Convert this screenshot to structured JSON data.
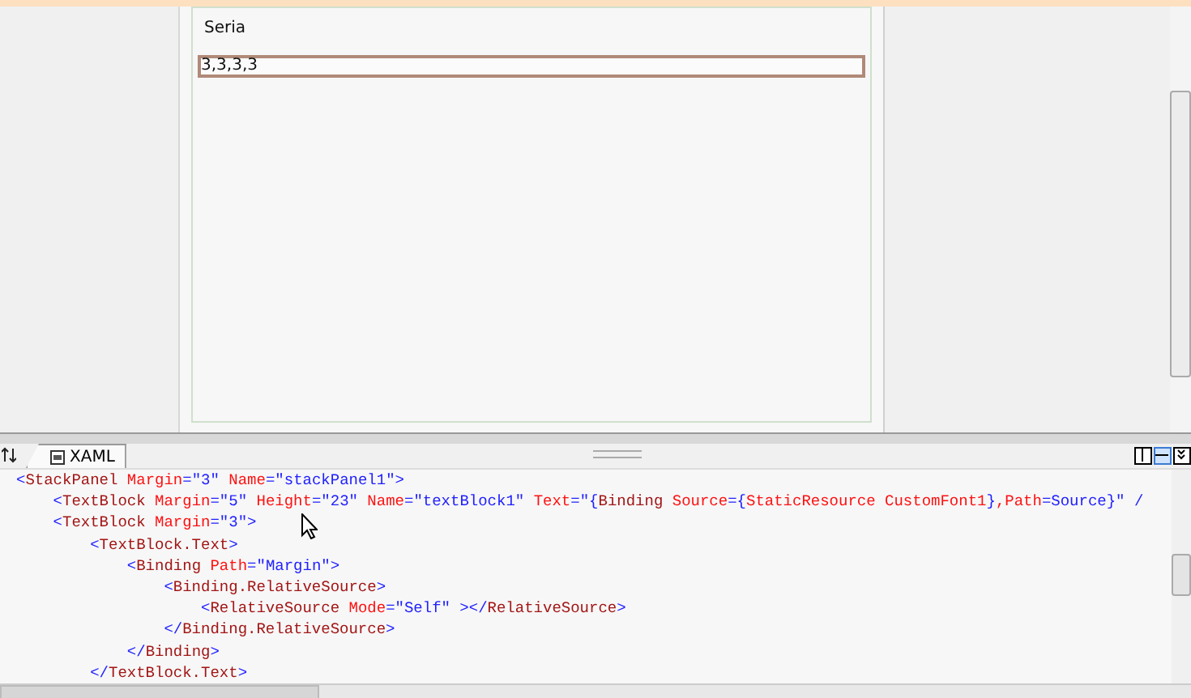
{
  "designer": {
    "label_text": "Seria",
    "textbox_value": "3,3,3,3"
  },
  "editor_tabs": [
    {
      "label": "XAML",
      "selected": true
    }
  ],
  "view_buttons": [
    {
      "kind": "vertical-split",
      "selected": false
    },
    {
      "kind": "horizontal-split",
      "selected": true
    },
    {
      "kind": "collapse",
      "selected": false
    }
  ],
  "code_lines": [
    {
      "tokens": [
        {
          "kind": "punct",
          "text": "<"
        },
        {
          "kind": "tag",
          "text": "StackPanel"
        },
        {
          "kind": "attr",
          "text": " Margin"
        },
        {
          "kind": "value",
          "text": "=\"3\""
        },
        {
          "kind": "attr",
          "text": " Name"
        },
        {
          "kind": "value",
          "text": "=\"stackPanel1\">"
        }
      ],
      "children": [
        {
          "tokens": [
            {
              "kind": "punct",
              "text": "<"
            },
            {
              "kind": "tag",
              "text": "TextBlock"
            },
            {
              "kind": "attr",
              "text": " Margin"
            },
            {
              "kind": "value",
              "text": "=\"5\""
            },
            {
              "kind": "attr",
              "text": " Height"
            },
            {
              "kind": "value",
              "text": "=\"23\""
            },
            {
              "kind": "attr",
              "text": " Name"
            },
            {
              "kind": "value",
              "text": "=\"textBlock1\""
            },
            {
              "kind": "attr",
              "text": " Text"
            },
            {
              "kind": "value",
              "text": "=\"{"
            },
            {
              "kind": "tag",
              "text": "Binding"
            },
            {
              "kind": "attr",
              "text": " Source"
            },
            {
              "kind": "value",
              "text": "={"
            },
            {
              "kind": "attr",
              "text": "StaticResource CustomFont1"
            },
            {
              "kind": "value",
              "text": "}"
            },
            {
              "kind": "attr",
              "text": ",Path"
            },
            {
              "kind": "value",
              "text": "=Source}\" /"
            }
          ]
        },
        {
          "tokens": [
            {
              "kind": "punct",
              "text": "<"
            },
            {
              "kind": "tag",
              "text": "TextBlock"
            },
            {
              "kind": "attr",
              "text": " Margin"
            },
            {
              "kind": "value",
              "text": "=\"3\">"
            }
          ],
          "children": [
            {
              "tokens": [
                {
                  "kind": "punct",
                  "text": "<"
                },
                {
                  "kind": "tag",
                  "text": "TextBlock.Text"
                },
                {
                  "kind": "punct",
                  "text": ">"
                }
              ],
              "children": [
                {
                  "tokens": [
                    {
                      "kind": "punct",
                      "text": "<"
                    },
                    {
                      "kind": "tag",
                      "text": "Binding"
                    },
                    {
                      "kind": "attr",
                      "text": " Path"
                    },
                    {
                      "kind": "value",
                      "text": "=\"Margin\">"
                    }
                  ],
                  "children": [
                    {
                      "tokens": [
                        {
                          "kind": "punct",
                          "text": "<"
                        },
                        {
                          "kind": "tag",
                          "text": "Binding.RelativeSource"
                        },
                        {
                          "kind": "punct",
                          "text": ">"
                        }
                      ],
                      "children": [
                        {
                          "tokens": [
                            {
                              "kind": "punct",
                              "text": "<"
                            },
                            {
                              "kind": "tag",
                              "text": "RelativeSource"
                            },
                            {
                              "kind": "attr",
                              "text": " Mode"
                            },
                            {
                              "kind": "value",
                              "text": "=\"Self\" ></"
                            },
                            {
                              "kind": "tag",
                              "text": "RelativeSource"
                            },
                            {
                              "kind": "punct",
                              "text": ">"
                            }
                          ]
                        }
                      ]
                    },
                    {
                      "tokens": [
                        {
                          "kind": "punct",
                          "text": "</"
                        },
                        {
                          "kind": "tag",
                          "text": "Binding.RelativeSource"
                        },
                        {
                          "kind": "punct",
                          "text": ">"
                        }
                      ]
                    }
                  ]
                },
                {
                  "tokens": [
                    {
                      "kind": "punct",
                      "text": "</"
                    },
                    {
                      "kind": "tag",
                      "text": "Binding"
                    },
                    {
                      "kind": "punct",
                      "text": ">"
                    }
                  ]
                }
              ]
            },
            {
              "tokens": [
                {
                  "kind": "punct",
                  "text": "</"
                },
                {
                  "kind": "tag",
                  "text": "TextBlock.Text"
                },
                {
                  "kind": "punct",
                  "text": ">"
                }
              ]
            }
          ]
        }
      ]
    }
  ]
}
